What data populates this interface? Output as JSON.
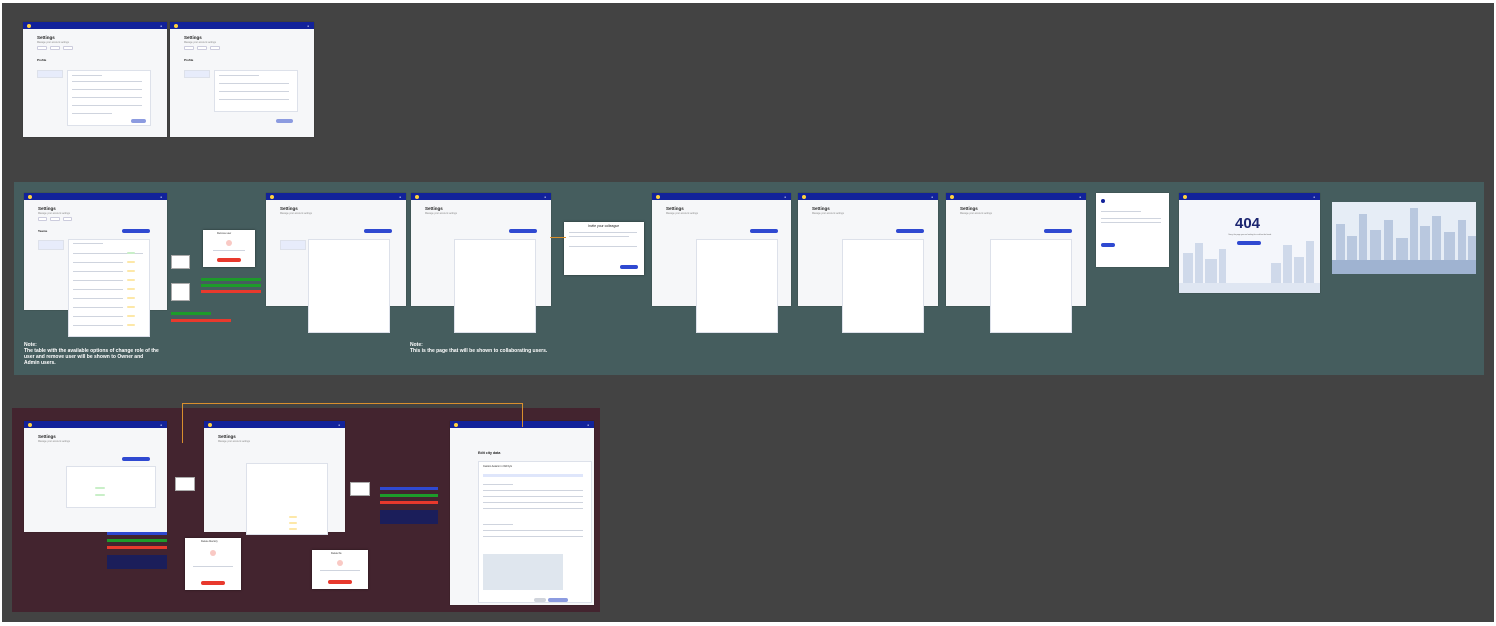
{
  "board": {
    "corner_label": "",
    "notes": {
      "teal_left": "Note:\nThe table with the available options of change role of the user and remove user will be shown to Owner and Admin users.",
      "teal_middle": "Note:\nThis is the page that will be shown to collaborating users."
    }
  },
  "screens": {
    "settings_title": "Settings",
    "settings_subtitle": "Manage your account settings",
    "profile_heading": "Profile",
    "teams_heading": "Teams",
    "share_dialog_title": "Invite your colleague",
    "remove_dialog_title": "Remove user",
    "delete_dir_title": "Delete directory",
    "delete_file_title": "Delete file",
    "error_code": "404",
    "error_message": "Sorry, the page you are looking for could not be found.",
    "edit_title": "Edit city data",
    "edit_subtitle": "Custom Autumn in Old Kyiv"
  },
  "colors": {
    "canvas": "#434343",
    "teal_section": "#455d5e",
    "plum_section": "#43242f",
    "topbar": "#12229a",
    "primary": "#2f49d1",
    "danger": "#e8392d",
    "success": "#1d9b2a"
  }
}
